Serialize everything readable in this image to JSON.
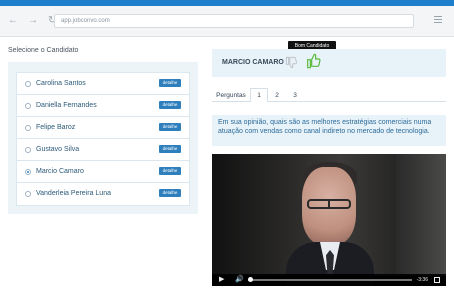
{
  "browser": {
    "address": "app.jobconvo.com"
  },
  "candidates": {
    "title": "Selecione o Candidato",
    "items": [
      {
        "name": "Carolina Santos",
        "detail_label": "detalhe"
      },
      {
        "name": "Daniella Fernandes",
        "detail_label": "detalhe"
      },
      {
        "name": "Felipe Baroz",
        "detail_label": "detalhe"
      },
      {
        "name": "Gustavo Silva",
        "detail_label": "detalhe"
      },
      {
        "name": "Marcio Camaro",
        "detail_label": "detalhe"
      },
      {
        "name": "Vanderleia Pereira Luna",
        "detail_label": "detalhe"
      }
    ]
  },
  "review": {
    "candidate_name": "MARCIO CAMARO",
    "tooltip": "Bom Candidato",
    "thumb_down_icon": "thumbs-down-icon",
    "thumb_up_icon": "thumbs-up-icon",
    "tabs": [
      "Perguntas",
      "1",
      "2",
      "3"
    ],
    "question": "Em sua opinião, quais são as melhores estratégias comerciais numa atuação com vendas como canal indireto no mercado de tecnologia."
  },
  "video": {
    "time": "-3:36",
    "play_icon": "play-icon",
    "volume_icon": "volume-icon",
    "fullscreen_icon": "fullscreen-icon"
  }
}
